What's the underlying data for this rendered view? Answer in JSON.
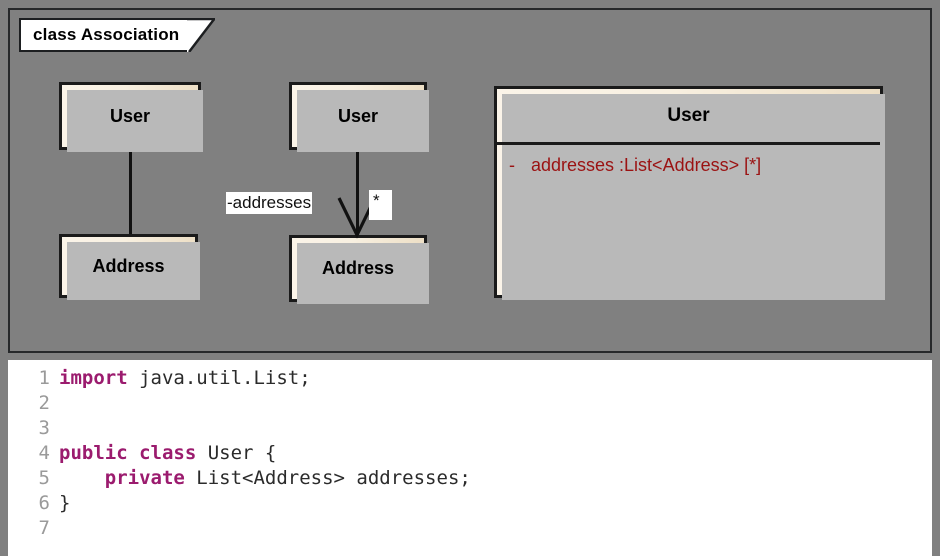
{
  "diagram": {
    "title": "class Association",
    "background_color": "#808080",
    "box_fill_left": "#fbf4e9",
    "box_fill_right": "#eddfc6",
    "border_color": "#1a1a1a",
    "shadow_color": "#b9b9b9",
    "attribute_text_color": "#9b1212",
    "examples": [
      {
        "id": "plain-association",
        "source": {
          "name": "User"
        },
        "target": {
          "name": "Address"
        },
        "connector": "plain-line",
        "labels": []
      },
      {
        "id": "directed-association",
        "source": {
          "name": "User"
        },
        "target": {
          "name": "Address"
        },
        "connector": "open-arrow",
        "labels": [
          {
            "id": "role",
            "text": "-addresses"
          },
          {
            "id": "multiplicity",
            "text": "*"
          }
        ]
      },
      {
        "id": "attribute-notation",
        "class_name": "User",
        "attributes": [
          {
            "visibility": "-",
            "text": "addresses :List<Address> [*]"
          }
        ]
      }
    ]
  },
  "code_editor": {
    "language": "java",
    "lines": [
      {
        "no": "1",
        "segments": [
          {
            "t": "import",
            "k": true
          },
          {
            "t": " java.util.List;",
            "k": false
          }
        ]
      },
      {
        "no": "2",
        "segments": []
      },
      {
        "no": "3",
        "segments": []
      },
      {
        "no": "4",
        "segments": [
          {
            "t": "public class",
            "k": true
          },
          {
            "t": " User {",
            "k": false
          }
        ]
      },
      {
        "no": "5",
        "segments": [
          {
            "t": "    ",
            "k": false
          },
          {
            "t": "private",
            "k": true
          },
          {
            "t": " List<Address> addresses;",
            "k": false
          }
        ]
      },
      {
        "no": "6",
        "segments": [
          {
            "t": "}",
            "k": false
          }
        ]
      },
      {
        "no": "7",
        "segments": []
      }
    ],
    "keyword_color": "#9b1b6e",
    "line_number_color": "#9a9a9a",
    "text_color": "#2b2b2b"
  }
}
